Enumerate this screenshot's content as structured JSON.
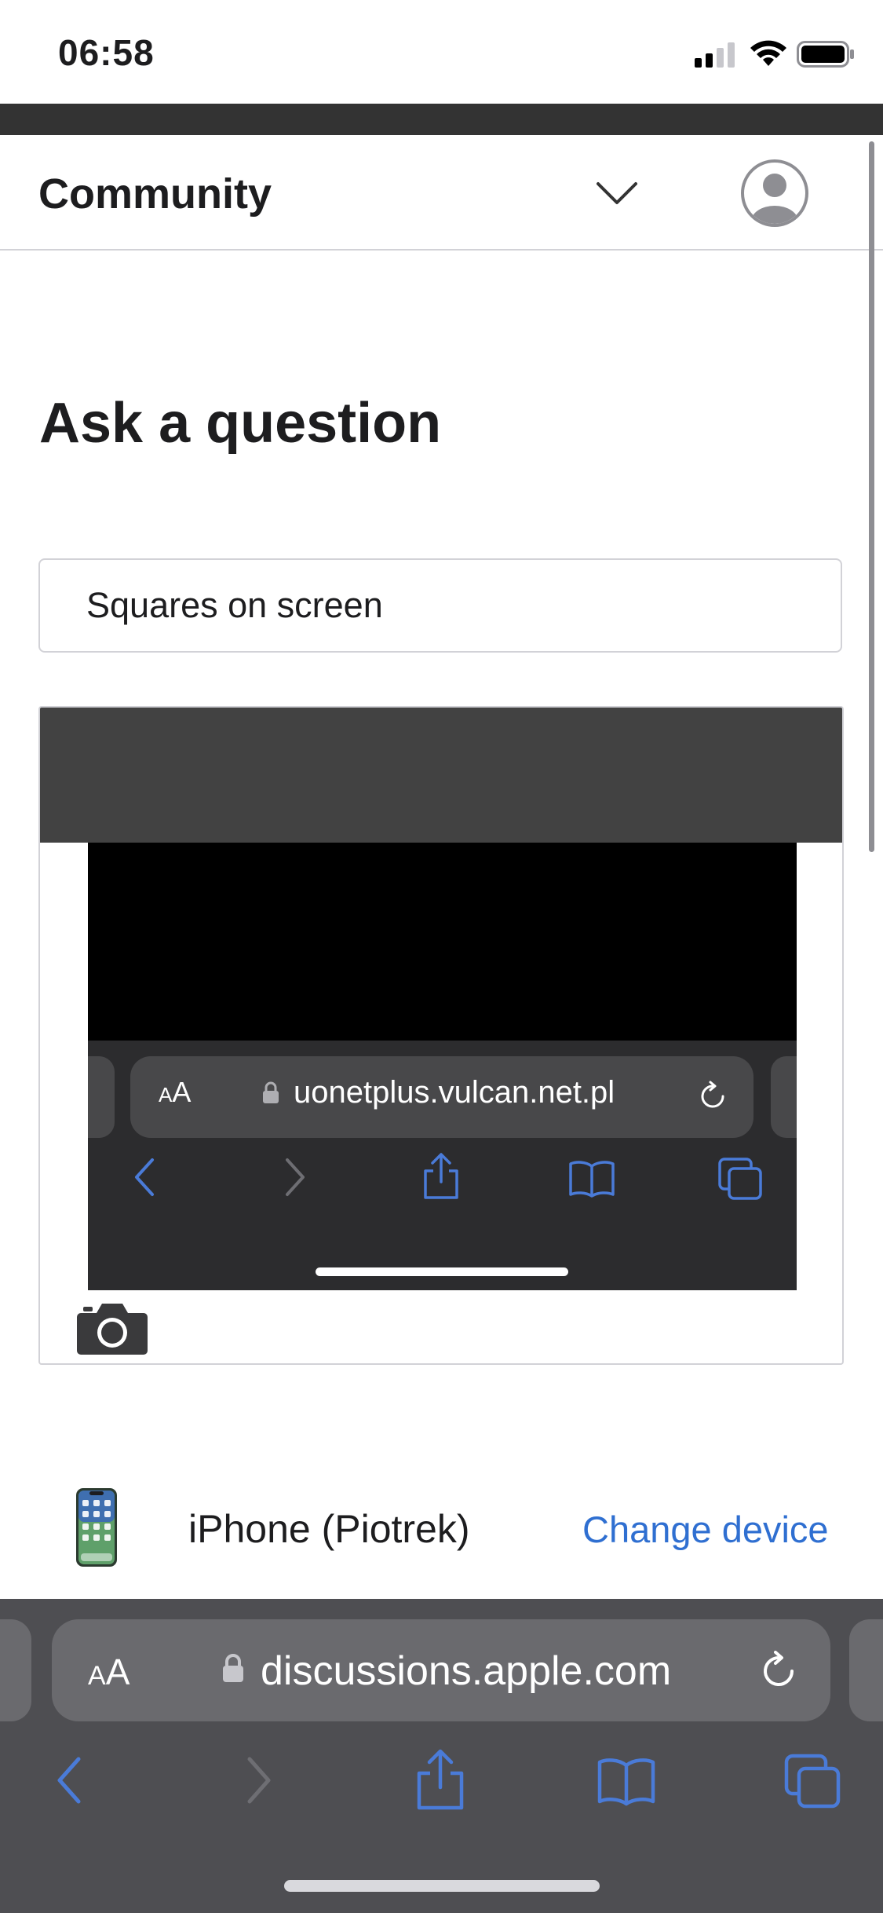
{
  "status_bar": {
    "time": "06:58",
    "icons": [
      "cellular-signal-icon",
      "wifi-icon",
      "battery-icon"
    ]
  },
  "header": {
    "title": "Community",
    "icons": [
      "chevron-down-icon",
      "account-avatar-icon"
    ]
  },
  "page": {
    "heading": "Ask a question"
  },
  "question_form": {
    "subject_value": "Squares on screen",
    "attachment": {
      "address_bar": {
        "aa_small": "A",
        "aa_large": "A",
        "url": "uonetplus.vulcan.net.pl"
      },
      "toolbar_icons": [
        "back-icon",
        "forward-icon",
        "share-icon",
        "bookmarks-icon",
        "tabs-icon"
      ]
    },
    "camera_icon": "camera-icon"
  },
  "device": {
    "name": "iPhone (Piotrek)",
    "change_label": "Change device"
  },
  "safari": {
    "aa_small": "A",
    "aa_large": "A",
    "url": "discussions.apple.com",
    "toolbar_icons": [
      "back-icon",
      "forward-icon",
      "share-icon",
      "bookmarks-icon",
      "tabs-icon"
    ]
  },
  "colors": {
    "link": "#2f6fd1",
    "toolbar_icon": "#4a7bd8",
    "safari_bar": "#4e4e52",
    "dark_strip": "#333333"
  }
}
